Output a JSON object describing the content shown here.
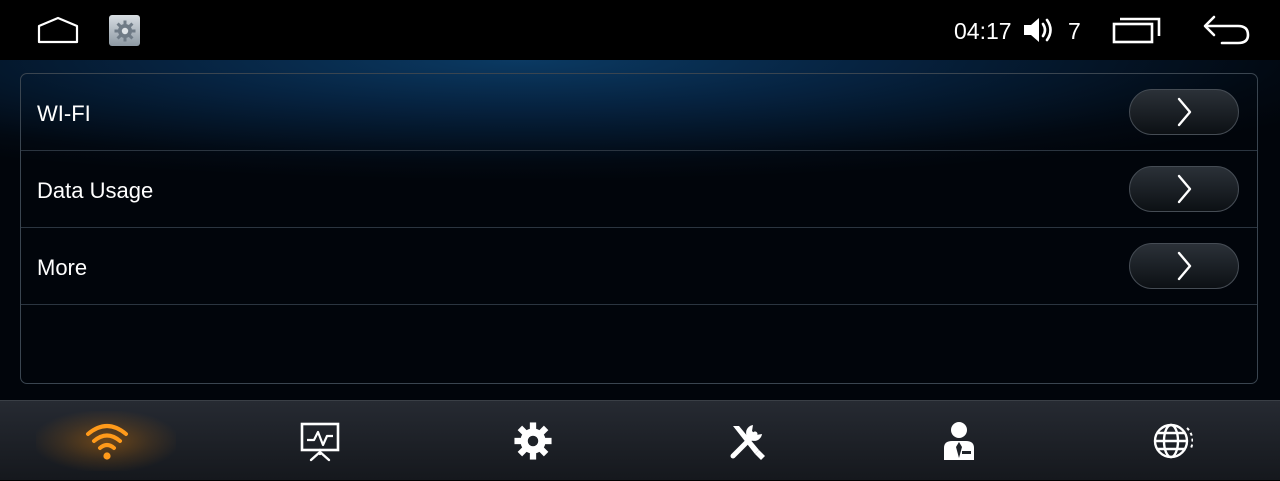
{
  "statusbar": {
    "time": "04:17",
    "volume_level": "7"
  },
  "settings_rows": [
    {
      "label": "WI-FI"
    },
    {
      "label": "Data Usage"
    },
    {
      "label": "More"
    }
  ],
  "tabs": [
    {
      "icon": "wifi-icon",
      "active": true
    },
    {
      "icon": "presentation-chart-icon",
      "active": false
    },
    {
      "icon": "gear-icon",
      "active": false
    },
    {
      "icon": "tools-icon",
      "active": false
    },
    {
      "icon": "user-profile-icon",
      "active": false
    },
    {
      "icon": "globe-icon",
      "active": false
    }
  ],
  "colors": {
    "accent": "#ff9a1a",
    "text": "#ffffff",
    "background": "#000000"
  }
}
